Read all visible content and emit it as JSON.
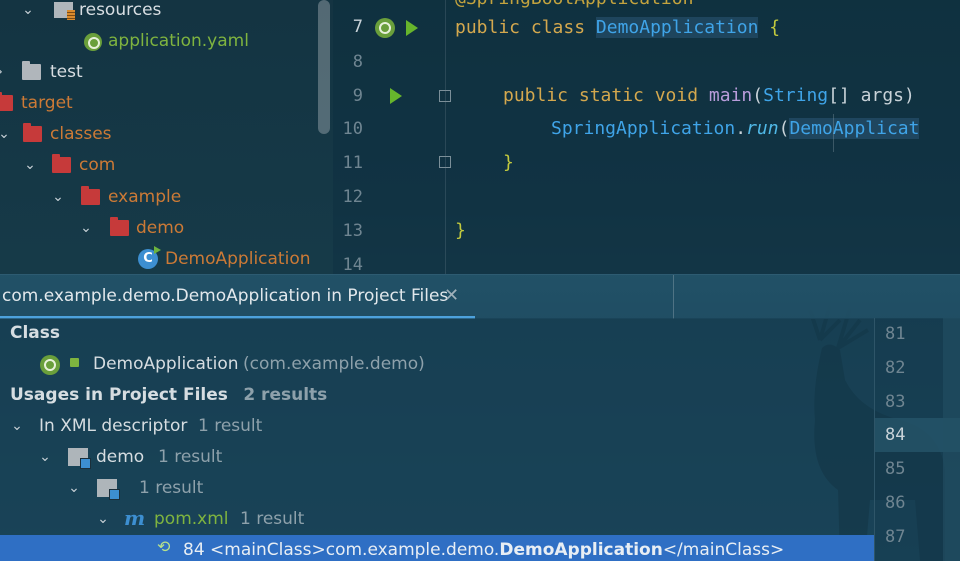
{
  "project_tree": {
    "rows": [
      {
        "label": "resources"
      },
      {
        "label": "application.yaml"
      },
      {
        "label": "test"
      },
      {
        "label": "target"
      },
      {
        "label": "classes"
      },
      {
        "label": "com"
      },
      {
        "label": "example"
      },
      {
        "label": "demo"
      },
      {
        "label": "DemoApplication"
      }
    ]
  },
  "editor": {
    "line_numbers": [
      "7",
      "8",
      "9",
      "10",
      "11",
      "12",
      "13",
      "14"
    ],
    "partial_top_line": "@SpringBootApplication",
    "code": {
      "line7_kw": "public class ",
      "line7_cls": "DemoApplication",
      "line7_brace": " {",
      "line9_kw": "public static void ",
      "line9_fn": "main",
      "line9_paren": "(",
      "line9_type": "String",
      "line9_rest": "[] args)",
      "line10_cls": "SpringApplication",
      "line10_dot": ".",
      "line10_mth": "run",
      "line10_paren": "(",
      "line10_arg": "DemoApplicat",
      "line11": "}",
      "line13": "}"
    }
  },
  "find_panel": {
    "tab_label": "com.example.demo.DemoApplication in Project Files",
    "close_glyph": "✕",
    "class_header": "Class",
    "class_name": "DemoApplication",
    "class_pkg": "(com.example.demo)",
    "usages_header": "Usages in Project Files",
    "usages_count": "2 results",
    "groups": [
      {
        "label": "In XML descriptor",
        "count": "1 result"
      },
      {
        "label": "demo",
        "count": "1 result"
      },
      {
        "label": "",
        "count": "1 result"
      },
      {
        "label": "pom.xml",
        "count": "1 result"
      }
    ],
    "selected_usage": {
      "line": "84",
      "prefix": "<mainClass>com.example.demo.",
      "match": "DemoApplication",
      "suffix": "</mainClass>"
    }
  },
  "preview": {
    "line_numbers": [
      "81",
      "82",
      "83",
      "84",
      "85",
      "86",
      "87"
    ]
  },
  "colors": {
    "selection": "#2f6fc4",
    "accent": "#4da2dd",
    "keyword": "#d4a84e",
    "class": "#3fa4e8"
  }
}
